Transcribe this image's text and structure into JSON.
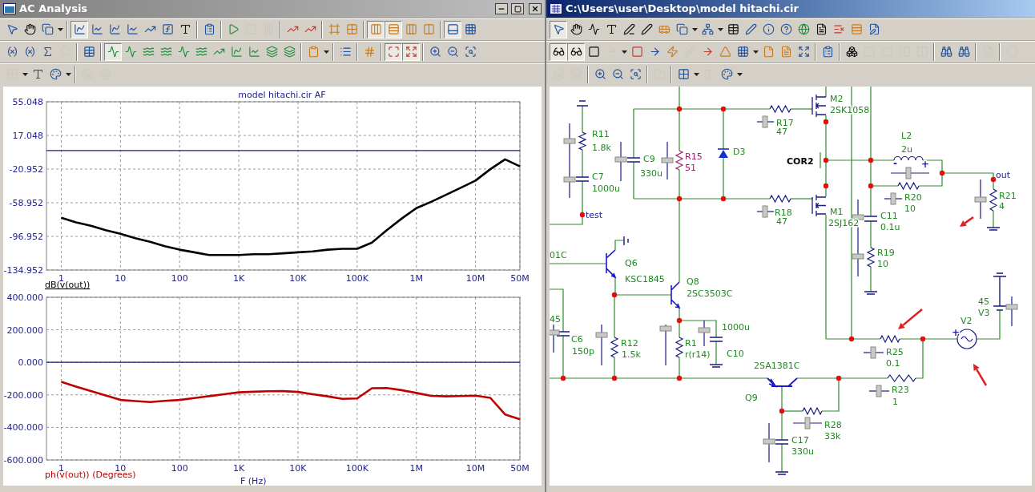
{
  "left_window": {
    "title": "AC Analysis",
    "toolbar_rows": [
      [
        [
          {
            "pressed": false,
            "disabled": false
          },
          {
            "pressed": false,
            "disabled": false
          },
          {
            "pressed": false,
            "disabled": false
          }
        ],
        [
          {
            "pressed": true,
            "disabled": false
          },
          {
            "pressed": false,
            "disabled": false
          },
          {
            "pressed": false,
            "disabled": false
          },
          {
            "pressed": false,
            "disabled": false
          },
          {
            "pressed": false,
            "disabled": false
          },
          {
            "pressed": false,
            "disabled": false
          },
          {
            "pressed": false,
            "disabled": false
          }
        ],
        [
          {
            "pressed": false,
            "disabled": false
          }
        ],
        [
          {
            "pressed": false,
            "disabled": false
          },
          {
            "pressed": false,
            "disabled": true
          },
          {
            "pressed": false,
            "disabled": true
          }
        ],
        [
          {
            "pressed": false,
            "disabled": false
          },
          {
            "pressed": false,
            "disabled": false
          }
        ],
        [
          {
            "pressed": false,
            "disabled": false
          },
          {
            "pressed": false,
            "disabled": false
          }
        ],
        [
          {
            "pressed": true,
            "disabled": false
          },
          {
            "pressed": true,
            "disabled": false
          },
          {
            "pressed": false,
            "disabled": false
          },
          {
            "pressed": false,
            "disabled": false
          }
        ],
        [
          {
            "pressed": true,
            "disabled": false
          },
          {
            "pressed": false,
            "disabled": false
          }
        ]
      ],
      [
        [
          {
            "pressed": false,
            "disabled": false
          },
          {
            "pressed": false,
            "disabled": false
          },
          {
            "pressed": false,
            "disabled": false
          },
          {
            "pressed": false,
            "disabled": true
          }
        ],
        [
          {
            "pressed": false,
            "disabled": false
          }
        ],
        [
          {
            "pressed": true,
            "disabled": false
          },
          {
            "pressed": false,
            "disabled": false
          },
          {
            "pressed": false,
            "disabled": false
          },
          {
            "pressed": false,
            "disabled": false
          },
          {
            "pressed": false,
            "disabled": false
          },
          {
            "pressed": false,
            "disabled": false
          },
          {
            "pressed": false,
            "disabled": false
          },
          {
            "pressed": false,
            "disabled": false
          },
          {
            "pressed": false,
            "disabled": false
          },
          {
            "pressed": false,
            "disabled": false
          },
          {
            "pressed": false,
            "disabled": false
          }
        ],
        [
          {
            "pressed": false,
            "disabled": false
          }
        ],
        [
          {
            "pressed": false,
            "disabled": false
          }
        ],
        [
          {
            "pressed": false,
            "disabled": false
          }
        ],
        [
          {
            "pressed": true,
            "disabled": false
          },
          {
            "pressed": true,
            "disabled": false
          }
        ],
        [
          {
            "pressed": false,
            "disabled": false
          },
          {
            "pressed": false,
            "disabled": false
          },
          {
            "pressed": false,
            "disabled": false
          }
        ]
      ],
      [
        [
          {
            "pressed": false,
            "disabled": true
          },
          {
            "pressed": false,
            "disabled": false
          },
          {
            "pressed": false,
            "disabled": false
          }
        ],
        [
          {
            "pressed": false,
            "disabled": true
          },
          {
            "pressed": false,
            "disabled": true
          }
        ]
      ]
    ],
    "magnitude_plot": {
      "chart_data": {
        "type": "line",
        "title": "model hitachi.cir AF",
        "grid": true,
        "ref_lines": [
          {
            "axis": "y",
            "value": 0,
            "color": "#1a1a7a"
          }
        ],
        "categories": [
          "1",
          null,
          null,
          null,
          "10",
          null,
          null,
          null,
          "100",
          null,
          null,
          null,
          "1K",
          null,
          null,
          null,
          "10K",
          null,
          null,
          null,
          "100K",
          null,
          null,
          null,
          "1M",
          null,
          null,
          null,
          "10M",
          null,
          null,
          "50M"
        ],
        "series": [
          {
            "name": "dB(v(out))",
            "color": "#000000",
            "values": [
              -76,
              -81,
              -85,
              -90,
              -94,
              -99,
              -103,
              -108,
              -112,
              -115,
              -118,
              -118,
              -118,
              -117,
              -117,
              -116,
              -115,
              -114,
              -112,
              -111,
              -111,
              -104,
              -90,
              -77,
              -65,
              -58,
              -50,
              -42,
              -34,
              -21,
              -10,
              -18
            ]
          }
        ],
        "ylim": [
          -134.952,
          55.048
        ],
        "yticks": [
          {
            "value": 55.048,
            "label": "55.048"
          },
          {
            "value": 17.048,
            "label": "17.048"
          },
          {
            "value": -20.952,
            "label": "-20.952"
          },
          {
            "value": -58.952,
            "label": "-58.952"
          },
          {
            "value": -96.952,
            "label": "-96.952"
          },
          {
            "value": -134.952,
            "label": "-134.952"
          }
        ]
      }
    },
    "phase_plot": {
      "chart_data": {
        "type": "line",
        "xlabel": "F (Hz)",
        "grid": true,
        "ref_lines": [
          {
            "axis": "y",
            "value": 0,
            "color": "#1a1a7a"
          }
        ],
        "categories": [
          "1",
          null,
          null,
          null,
          "10",
          null,
          null,
          null,
          "100",
          null,
          null,
          null,
          "1K",
          null,
          null,
          null,
          "10K",
          null,
          null,
          null,
          "100K",
          null,
          null,
          null,
          "1M",
          null,
          null,
          null,
          "10M",
          null,
          null,
          "50M"
        ],
        "series": [
          {
            "name": "ph(v(out)) (Degrees)",
            "color": "#c00000",
            "values": [
              -120,
              -149,
              -177,
              -204,
              -231,
              -238,
              -244,
              -237,
              -231,
              -219,
              -208,
              -196,
              -184,
              -181,
              -178,
              -177,
              -182,
              -196,
              -209,
              -224,
              -222,
              -159,
              -158,
              -171,
              -188,
              -206,
              -209,
              -207,
              -205,
              -218,
              -320,
              -350
            ]
          }
        ],
        "ylim": [
          -600,
          400
        ],
        "yticks": [
          {
            "value": 400,
            "label": "400.000"
          },
          {
            "value": 200,
            "label": "200.000"
          },
          {
            "value": 0,
            "label": "0.000"
          },
          {
            "value": -200,
            "label": "-200.000"
          },
          {
            "value": -400,
            "label": "-400.000"
          },
          {
            "value": -600,
            "label": "-600.000"
          }
        ]
      }
    }
  },
  "right_window": {
    "title": "C:\\Users\\user\\Desktop\\model hitachi.cir",
    "toolbar_rows": [
      [
        [
          {
            "pressed": true,
            "disabled": false
          },
          {
            "pressed": false,
            "disabled": false
          },
          {
            "pressed": false,
            "disabled": false
          },
          {
            "pressed": false,
            "disabled": false
          },
          {
            "pressed": false,
            "disabled": false
          },
          {
            "pressed": false,
            "disabled": false
          },
          {
            "pressed": false,
            "disabled": false
          },
          {
            "pressed": false,
            "disabled": false
          },
          {
            "pressed": false,
            "disabled": false
          },
          {
            "pressed": false,
            "disabled": false
          },
          {
            "pressed": false,
            "disabled": false
          },
          {
            "pressed": false,
            "disabled": false
          },
          {
            "pressed": false,
            "disabled": false
          },
          {
            "pressed": false,
            "disabled": false
          },
          {
            "pressed": false,
            "disabled": false
          },
          {
            "pressed": false,
            "disabled": false
          },
          {
            "pressed": false,
            "disabled": false
          },
          {
            "pressed": false,
            "disabled": false
          }
        ]
      ],
      [
        [
          {
            "pressed": true,
            "disabled": false
          },
          {
            "pressed": true,
            "disabled": false
          },
          {
            "pressed": false,
            "disabled": false
          },
          {
            "pressed": false,
            "disabled": true
          },
          {
            "pressed": false,
            "disabled": false
          },
          {
            "pressed": false,
            "disabled": false
          },
          {
            "pressed": false,
            "disabled": false
          },
          {
            "pressed": false,
            "disabled": true
          },
          {
            "pressed": false,
            "disabled": false
          },
          {
            "pressed": false,
            "disabled": false
          },
          {
            "pressed": false,
            "disabled": false
          },
          {
            "pressed": false,
            "disabled": false
          },
          {
            "pressed": false,
            "disabled": false
          },
          {
            "pressed": false,
            "disabled": false
          }
        ],
        [
          {
            "pressed": false,
            "disabled": false
          }
        ],
        [
          {
            "pressed": false,
            "disabled": false
          },
          {
            "pressed": false,
            "disabled": true
          },
          {
            "pressed": false,
            "disabled": true
          },
          {
            "pressed": false,
            "disabled": true
          },
          {
            "pressed": false,
            "disabled": true
          }
        ],
        [
          {
            "pressed": false,
            "disabled": false
          },
          {
            "pressed": false,
            "disabled": false
          }
        ],
        [
          {
            "pressed": false,
            "disabled": true
          }
        ],
        [
          {
            "pressed": false,
            "disabled": true
          }
        ]
      ],
      [
        [
          {
            "pressed": false,
            "disabled": true
          },
          {
            "pressed": false,
            "disabled": true
          }
        ],
        [
          {
            "pressed": false,
            "disabled": false
          },
          {
            "pressed": false,
            "disabled": false
          },
          {
            "pressed": false,
            "disabled": false
          }
        ],
        [
          {
            "pressed": false,
            "disabled": true
          }
        ],
        [
          {
            "pressed": false,
            "disabled": false
          },
          {
            "pressed": false,
            "disabled": true
          },
          {
            "pressed": false,
            "disabled": false
          }
        ]
      ]
    ],
    "schematic": {
      "labels": [
        {
          "text": "01C",
          "kind": "part",
          "color": "#1f8a1f"
        },
        {
          "text": "R11",
          "kind": "part",
          "color": "#1f8a1f"
        },
        {
          "text": "1.8k",
          "kind": "part",
          "color": "#1f8a1f"
        },
        {
          "text": "C7",
          "kind": "part",
          "color": "#1f8a1f"
        },
        {
          "text": "1000u",
          "kind": "part",
          "color": "#1f8a1f"
        },
        {
          "text": "test",
          "kind": "net",
          "color": "#1a1a9a"
        },
        {
          "text": "C9",
          "kind": "part",
          "color": "#1f8a1f"
        },
        {
          "text": "330u",
          "kind": "part",
          "color": "#1f8a1f"
        },
        {
          "text": "R15",
          "kind": "part",
          "color": "#a0206e"
        },
        {
          "text": "51",
          "kind": "part",
          "color": "#a0206e"
        },
        {
          "text": "D3",
          "kind": "part",
          "color": "#1f8a1f"
        },
        {
          "text": "R17",
          "kind": "part",
          "color": "#1f8a1f"
        },
        {
          "text": "47",
          "kind": "part",
          "color": "#1f8a1f"
        },
        {
          "text": "M2",
          "kind": "part",
          "color": "#1f8a1f"
        },
        {
          "text": "2SK1058",
          "kind": "part",
          "color": "#1f8a1f"
        },
        {
          "text": "COR2",
          "kind": "port",
          "color": "#000000"
        },
        {
          "text": "L2",
          "kind": "part",
          "color": "#1f8a1f"
        },
        {
          "text": "2u",
          "kind": "part",
          "color": "#1f8a1f"
        },
        {
          "text": "-",
          "kind": "pin",
          "color": "#1a1a9a"
        },
        {
          "text": "+",
          "kind": "pin",
          "color": "#1a1a9a"
        },
        {
          "text": "out",
          "kind": "net",
          "color": "#1a1a9a"
        },
        {
          "text": "R20",
          "kind": "part",
          "color": "#1f8a1f"
        },
        {
          "text": "10",
          "kind": "part",
          "color": "#1f8a1f"
        },
        {
          "text": "R21",
          "kind": "part",
          "color": "#1f8a1f"
        },
        {
          "text": "4",
          "kind": "part",
          "color": "#1f8a1f"
        },
        {
          "text": "R18",
          "kind": "part",
          "color": "#1f8a1f"
        },
        {
          "text": "47",
          "kind": "part",
          "color": "#1f8a1f"
        },
        {
          "text": "M1",
          "kind": "part",
          "color": "#1f8a1f"
        },
        {
          "text": "2SJ162",
          "kind": "part",
          "color": "#1f8a1f"
        },
        {
          "text": "C11",
          "kind": "part",
          "color": "#1f8a1f"
        },
        {
          "text": "0.1u",
          "kind": "part",
          "color": "#1f8a1f"
        },
        {
          "text": "R19",
          "kind": "part",
          "color": "#1f8a1f"
        },
        {
          "text": "10",
          "kind": "part",
          "color": "#1f8a1f"
        },
        {
          "text": "Q6",
          "kind": "part",
          "color": "#1f8a1f"
        },
        {
          "text": "KSC1845",
          "kind": "part",
          "color": "#1f8a1f"
        },
        {
          "text": "Q8",
          "kind": "part",
          "color": "#1f8a1f"
        },
        {
          "text": "2SC3503C",
          "kind": "part",
          "color": "#1f8a1f"
        },
        {
          "text": "45",
          "kind": "part",
          "color": "#1f8a1f"
        },
        {
          "text": "C6",
          "kind": "part",
          "color": "#1f8a1f"
        },
        {
          "text": "150p",
          "kind": "part",
          "color": "#1f8a1f"
        },
        {
          "text": "R12",
          "kind": "part",
          "color": "#1f8a1f"
        },
        {
          "text": "1.5k",
          "kind": "part",
          "color": "#1f8a1f"
        },
        {
          "text": "R1",
          "kind": "part",
          "color": "#1f8a1f"
        },
        {
          "text": "r(r14)",
          "kind": "part",
          "color": "#1f8a1f"
        },
        {
          "text": "1000u",
          "kind": "part",
          "color": "#1f8a1f"
        },
        {
          "text": "C10",
          "kind": "part",
          "color": "#1f8a1f"
        },
        {
          "text": "2SA1381C",
          "kind": "part",
          "color": "#1f8a1f"
        },
        {
          "text": "Q9",
          "kind": "part",
          "color": "#1f8a1f"
        },
        {
          "text": "V2",
          "kind": "part",
          "color": "#1f8a1f"
        },
        {
          "text": "45",
          "kind": "part",
          "color": "#1f8a1f"
        },
        {
          "text": "V3",
          "kind": "part",
          "color": "#1f8a1f"
        },
        {
          "text": "+",
          "kind": "pin",
          "color": "#1a1a9a"
        },
        {
          "text": "R25",
          "kind": "part",
          "color": "#1f8a1f"
        },
        {
          "text": "0.1",
          "kind": "part",
          "color": "#1f8a1f"
        },
        {
          "text": "R23",
          "kind": "part",
          "color": "#1f8a1f"
        },
        {
          "text": "1",
          "kind": "part",
          "color": "#1f8a1f"
        },
        {
          "text": "R28",
          "kind": "part",
          "color": "#1f8a1f"
        },
        {
          "text": "33k",
          "kind": "part",
          "color": "#1f8a1f"
        },
        {
          "text": "C17",
          "kind": "part",
          "color": "#1f8a1f"
        },
        {
          "text": "330u",
          "kind": "part",
          "color": "#1f8a1f"
        }
      ]
    }
  }
}
